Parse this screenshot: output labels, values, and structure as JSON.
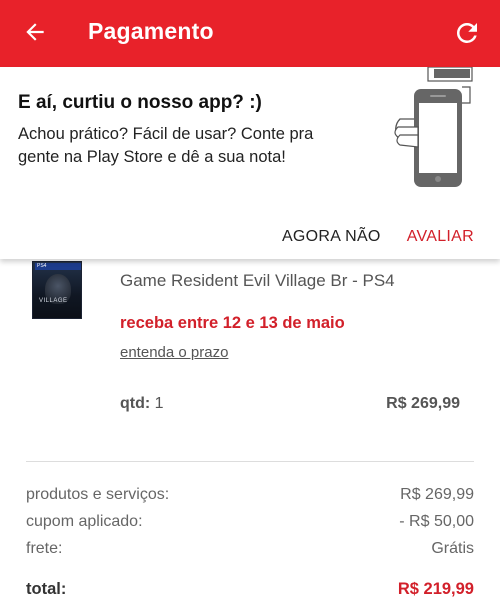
{
  "appbar": {
    "title": "Pagamento",
    "back_icon": "arrow-left-icon",
    "refresh_icon": "refresh-icon",
    "color": "#e8222a"
  },
  "rating_prompt": {
    "heading": "E aí, curtiu o nosso app? :)",
    "message": "Achou prático? Fácil de usar? Conte pra gente na Play Store e dê a sua nota!",
    "later_label": "AGORA NÃO",
    "rate_label": "AVALIAR",
    "illustration_icon": "hand-holding-phone-icon"
  },
  "product": {
    "name": "Game Resident Evil Village Br - PS4",
    "delivery": "receba entre 12 e 13 de maio",
    "delivery_link": "entenda o prazo",
    "qty_label": "qtd:",
    "qty_value": "1",
    "price": "R$ 269,99",
    "thumbnail_platform": "PS4",
    "thumbnail_title": "VILLAGE"
  },
  "summary": {
    "rows": [
      {
        "label": "produtos e serviços:",
        "value": "R$ 269,99"
      },
      {
        "label": "cupom aplicado:",
        "value": "- R$ 50,00"
      },
      {
        "label": "frete:",
        "value": "Grátis"
      }
    ],
    "total_label": "total:",
    "total_value": "R$ 219,99"
  },
  "colors": {
    "accent": "#d2202a",
    "text_muted": "#555555"
  }
}
